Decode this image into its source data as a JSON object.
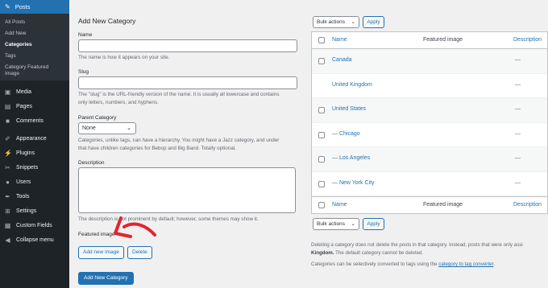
{
  "sidebar": {
    "top": {
      "label": "Posts",
      "icon": "pin-icon"
    },
    "sub": [
      {
        "label": "All Posts"
      },
      {
        "label": "Add New"
      },
      {
        "label": "Categories"
      },
      {
        "label": "Tags"
      },
      {
        "label": "Category Featured"
      },
      {
        "label": "Image"
      }
    ],
    "items": [
      {
        "label": "Media",
        "icon": "media-icon"
      },
      {
        "label": "Pages",
        "icon": "pages-icon"
      },
      {
        "label": "Comments",
        "icon": "comments-icon"
      },
      {
        "label": "Appearance",
        "icon": "appearance-icon"
      },
      {
        "label": "Plugins",
        "icon": "plugins-icon"
      },
      {
        "label": "Snippets",
        "icon": "snippets-icon"
      },
      {
        "label": "Users",
        "icon": "users-icon"
      },
      {
        "label": "Tools",
        "icon": "tools-icon"
      },
      {
        "label": "Settings",
        "icon": "settings-icon"
      },
      {
        "label": "Custom Fields",
        "icon": "custom-fields-icon"
      },
      {
        "label": "Collapse menu",
        "icon": "collapse-icon"
      }
    ]
  },
  "form": {
    "title": "Add New Category",
    "name_label": "Name",
    "name_desc": "The name is how it appears on your site.",
    "slug_label": "Slug",
    "slug_desc_1": "The \"slug\" is the URL-friendly version of the name. It is usually all lowercase and contains",
    "slug_desc_2": "only letters, numbers, and hyphens.",
    "parent_label": "Parent Category",
    "parent_value": "None",
    "parent_desc_1": "Categories, unlike tags, can have a hierarchy. You might have a Jazz category, and under",
    "parent_desc_2": "that have children categories for Bebop and Big Band. Totally optional.",
    "description_label": "Description",
    "description_desc": "The description is not prominent by default; however, some themes may show it.",
    "featured_label": "Featured image",
    "add_image": "Add new image",
    "delete": "Delete",
    "submit": "Add New Category"
  },
  "table": {
    "bulk_label": "Bulk actions",
    "apply": "Apply",
    "headers": {
      "name": "Name",
      "featured": "Featured image",
      "description": "Description"
    },
    "rows": [
      {
        "name": "Canada",
        "desc": "—",
        "checkbox": true
      },
      {
        "name": "United Kingdom",
        "desc": "—",
        "checkbox": false
      },
      {
        "name": "United States",
        "desc": "—",
        "checkbox": true
      },
      {
        "name": "— Chicago",
        "desc": "—",
        "checkbox": true
      },
      {
        "name": "— Los Angeles",
        "desc": "—",
        "checkbox": true
      },
      {
        "name": "— New York City",
        "desc": "—",
        "checkbox": true
      }
    ],
    "note1_a": "Deleting a category does not delete the posts in that category. Instead, posts that were only assi",
    "note1_b": "Kingdom.",
    "note1_c": " The default category cannot be deleted.",
    "note2_a": "Categories can be selectively converted to tags using the ",
    "note2_link": "category to tag converter",
    "note2_b": "."
  },
  "colors": {
    "accent": "#2271b1",
    "sidebar": "#1d2327",
    "arrow": "#e0262f"
  }
}
